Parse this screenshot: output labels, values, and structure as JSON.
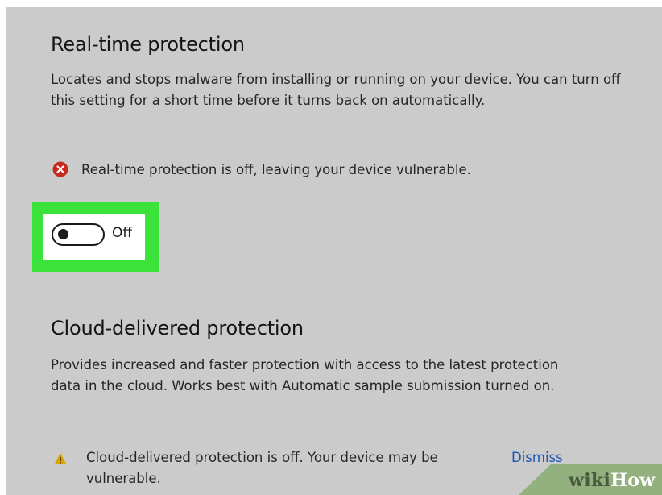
{
  "realtime": {
    "title": "Real-time protection",
    "description": "Locates and stops malware from installing or running on your device. You can turn off this setting for a short time before it turns back on automatically.",
    "status_icon": "error-circle-icon",
    "status_text": "Real-time protection is off, leaving your device vulnerable.",
    "toggle_label": "Off",
    "toggle_state": false
  },
  "cloud": {
    "title": "Cloud-delivered protection",
    "description": "Provides increased and faster protection with access to the latest protection data in the cloud.  Works best with Automatic sample submission turned on.",
    "warning_icon": "warning-triangle-icon",
    "warning_text": "Cloud-delivered protection is off. Your device may be vulnerable.",
    "dismiss_label": "Dismiss"
  },
  "watermark": {
    "part1": "wiki",
    "part2": "How"
  },
  "colors": {
    "panel_bg": "#cbcbcb",
    "highlight": "#3be23a",
    "error": "#c42b1c",
    "warning": "#d9a400",
    "link": "#1d54b8",
    "watermark_bg": "#93b07f"
  }
}
